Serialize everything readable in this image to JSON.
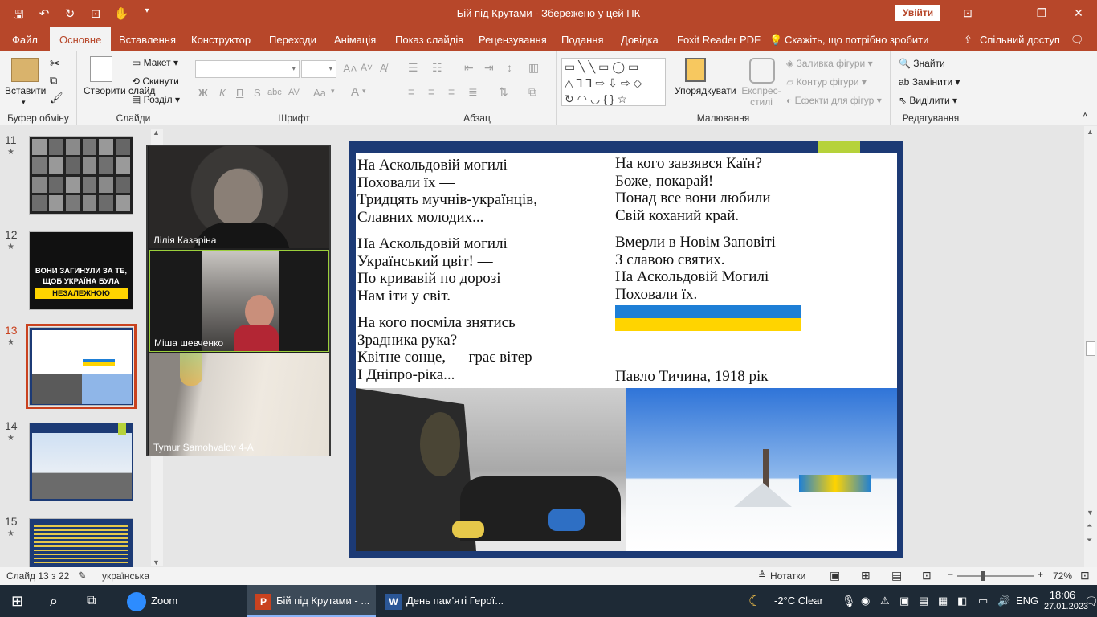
{
  "app": {
    "title": "Бій під Крутами  -  Збережено у цей ПК",
    "signin": "Увійти",
    "accent": "#b7472a"
  },
  "tabs": [
    "Файл",
    "Основне",
    "Вставлення",
    "Конструктор",
    "Переходи",
    "Анімація",
    "Показ слайдів",
    "Рецензування",
    "Подання",
    "Довідка",
    "Foxit Reader PDF"
  ],
  "tell_me": "Скажіть, що потрібно зробити",
  "share": "Спільний доступ",
  "ribbon": {
    "clipboard": {
      "paste": "Вставити",
      "label": "Буфер обміну"
    },
    "slides": {
      "new_slide": "Створити слайд",
      "layout": "Макет",
      "reset": "Скинути",
      "section": "Розділ",
      "label": "Слайди"
    },
    "font": {
      "bold": "Ж",
      "italic": "К",
      "underline": "П",
      "shadow": "S",
      "strike": "abc",
      "spacing": "AV",
      "case": "Aa",
      "label": "Шрифт"
    },
    "paragraph": {
      "label": "Абзац"
    },
    "drawing": {
      "arrange": "Упорядкувати",
      "quick_styles": "Експрес-стилі",
      "fill": "Заливка фігури",
      "outline": "Контур фігури",
      "effects": "Ефекти для фігур",
      "label": "Малювання"
    },
    "editing": {
      "find": "Знайти",
      "replace": "Замінити",
      "select": "Виділити",
      "label": "Редагування"
    }
  },
  "thumbnails": [
    {
      "num": "11",
      "star": "★"
    },
    {
      "num": "12",
      "star": "★",
      "text": [
        "ВОНИ ЗАГИНУЛИ ЗА ТЕ,",
        "ЩОБ УКРАЇНА БУЛА",
        "НЕЗАЛЕЖНОЮ"
      ]
    },
    {
      "num": "13",
      "star": "★"
    },
    {
      "num": "14",
      "star": "★"
    },
    {
      "num": "15",
      "star": "★"
    }
  ],
  "participants": [
    "Лілія Казаріна",
    "Міша шевченко",
    "Tymur Samohvalov 4-А"
  ],
  "slide": {
    "col1": [
      [
        "На Аскольдовій могилі",
        "Поховали їх —",
        "Тридцять мучнів-українців,",
        "Славних молодих..."
      ],
      [
        "На Аскольдовій могилі",
        "Український цвіт! —",
        "По кривавій по дорозі",
        "Нам іти у світ."
      ],
      [
        "На кого посміла знятись",
        "Зрадника рука?",
        "Квітне сонце, — грає вітер",
        "І Дніпро-ріка..."
      ]
    ],
    "col2": [
      [
        "На кого завзявся Каїн?",
        "Боже, покарай!",
        "Понад все вони любили",
        "Свій коханий край."
      ],
      [
        "Вмерли в Новім Заповіті",
        "З славою святих.",
        "На Аскольдовій Могилі",
        "Поховали їх."
      ]
    ],
    "author": "Павло Тичина, 1918 рік",
    "flag_blue": "#1e7fd6",
    "flag_yellow": "#ffd400"
  },
  "status": {
    "slide_of": "Слайд 13 з 22",
    "language": "українська",
    "notes": "Нотатки",
    "zoom": "72%"
  },
  "taskbar": {
    "apps": [
      "Zoom",
      "Бій під Крутами - ...",
      "День пам'яті Герої..."
    ],
    "weather": "-2°C  Clear",
    "lang": "ENG",
    "time": "18:06",
    "date": "27.01.2023"
  }
}
